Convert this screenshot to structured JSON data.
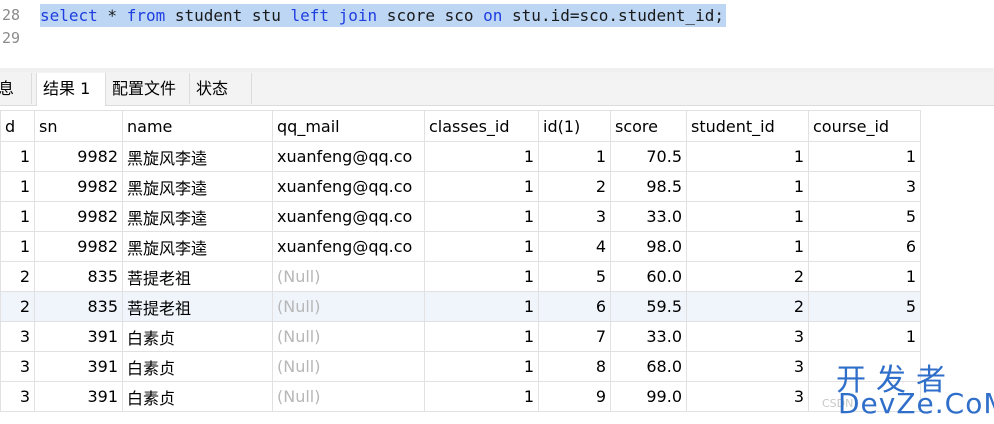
{
  "editor": {
    "lines": [
      {
        "number": "28",
        "tokens": [
          {
            "t": "select",
            "kw": true
          },
          {
            "t": " * ",
            "kw": false
          },
          {
            "t": "from",
            "kw": true
          },
          {
            "t": " student stu ",
            "kw": false
          },
          {
            "t": "left",
            "kw": true
          },
          {
            "t": " ",
            "kw": false
          },
          {
            "t": "join",
            "kw": true
          },
          {
            "t": " score sco ",
            "kw": false
          },
          {
            "t": "on",
            "kw": true
          },
          {
            "t": " stu.id=sco.student_id;",
            "kw": false
          }
        ]
      },
      {
        "number": "29",
        "tokens": []
      }
    ]
  },
  "tabs": [
    "息",
    "结果 1",
    "配置文件",
    "状态"
  ],
  "active_tab": 1,
  "grid": {
    "columns": [
      "d",
      "sn",
      "name",
      "qq_mail",
      "classes_id",
      "id(1)",
      "score",
      "student_id",
      "course_id"
    ],
    "rows": [
      [
        "1",
        "9982",
        "黑旋风李逵",
        "xuanfeng@qq.co",
        "1",
        "1",
        "70.5",
        "1",
        "1"
      ],
      [
        "1",
        "9982",
        "黑旋风李逵",
        "xuanfeng@qq.co",
        "1",
        "2",
        "98.5",
        "1",
        "3"
      ],
      [
        "1",
        "9982",
        "黑旋风李逵",
        "xuanfeng@qq.co",
        "1",
        "3",
        "33.0",
        "1",
        "5"
      ],
      [
        "1",
        "9982",
        "黑旋风李逵",
        "xuanfeng@qq.co",
        "1",
        "4",
        "98.0",
        "1",
        "6"
      ],
      [
        "2",
        "835",
        "菩提老祖",
        "(Null)",
        "1",
        "5",
        "60.0",
        "2",
        "1"
      ],
      [
        "2",
        "835",
        "菩提老祖",
        "(Null)",
        "1",
        "6",
        "59.5",
        "2",
        "5"
      ],
      [
        "3",
        "391",
        "白素贞",
        "(Null)",
        "1",
        "7",
        "33.0",
        "3",
        "1"
      ],
      [
        "3",
        "391",
        "白素贞",
        "(Null)",
        "1",
        "8",
        "68.0",
        "3",
        ""
      ],
      [
        "3",
        "391",
        "白素贞",
        "(Null)",
        "1",
        "9",
        "99.0",
        "3",
        ""
      ]
    ],
    "null_text": "(Null)"
  },
  "watermark": {
    "cn": "开发者",
    "en": "DevZe.CoM",
    "faint": "CSDN"
  },
  "colors": {
    "keyword": "#1f3ee0",
    "selection": "#bcd6f4",
    "null": "#b7b7b7",
    "alt_row": "#f0f5fb",
    "watermark": "#2f6ec9"
  }
}
